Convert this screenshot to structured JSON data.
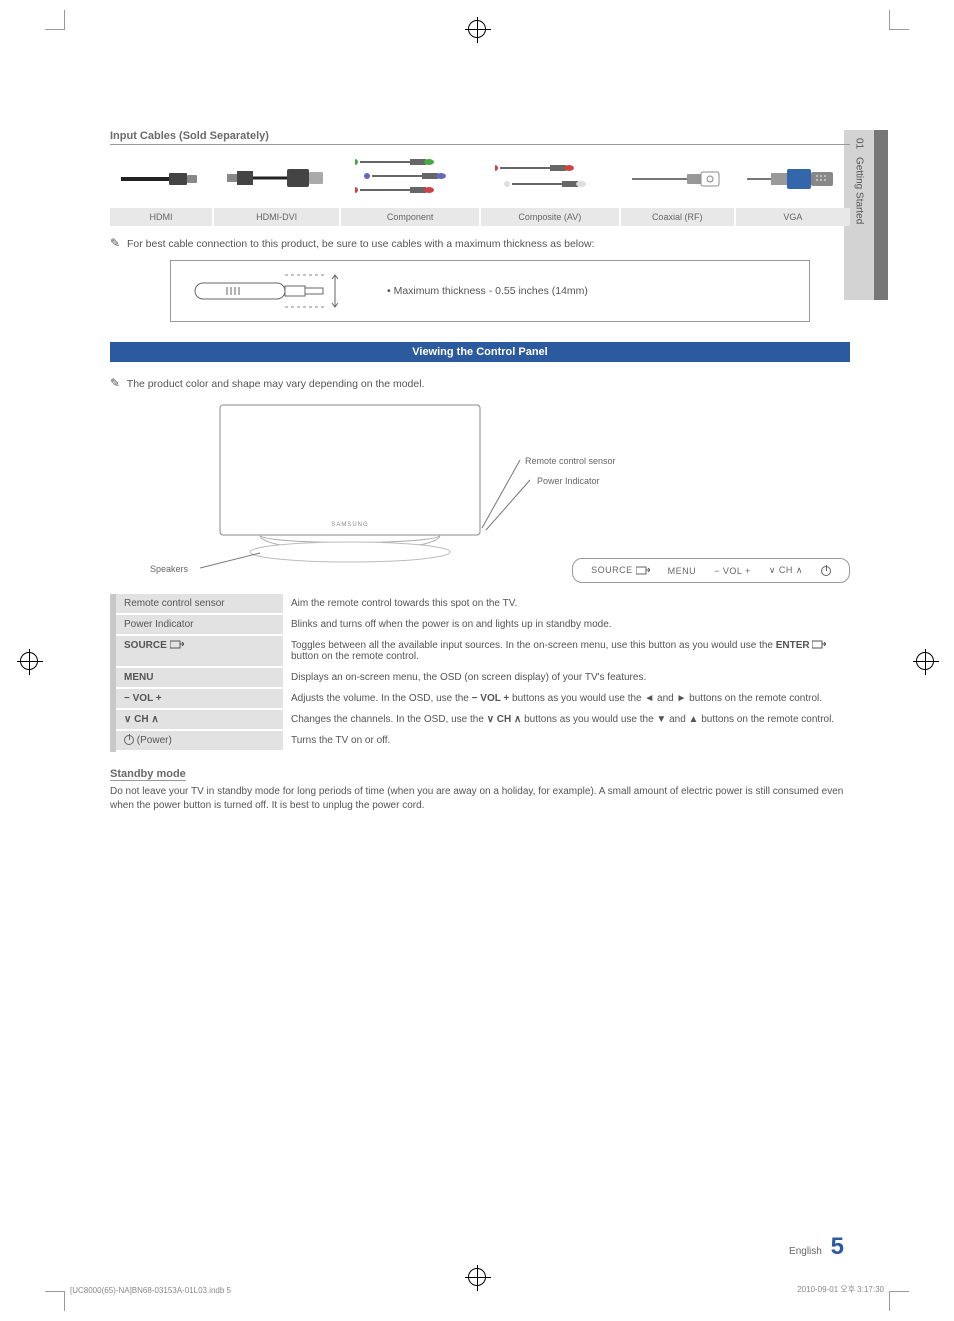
{
  "side_tab": {
    "num": "01",
    "title": "Getting Started"
  },
  "cables": {
    "heading": "Input Cables (Sold Separately)",
    "labels": [
      "HDMI",
      "HDMI-DVI",
      "Component",
      "Composite (AV)",
      "Coaxial (RF)",
      "VGA"
    ]
  },
  "note1": "For best cable connection to this product, be sure to use cables with a maximum thickness as below:",
  "thickness": "Maximum thickness - 0.55 inches (14mm)",
  "banner": "Viewing the Control Panel",
  "note2": "The product color and shape may vary depending on the model.",
  "tv_labels": {
    "remote_sensor": "Remote control sensor",
    "power_indicator": "Power Indicator",
    "speakers": "Speakers"
  },
  "button_strip": {
    "source": "SOURCE",
    "menu": "MENU",
    "vol": "− VOL +",
    "ch": "∨ CH ∧"
  },
  "controls": [
    {
      "name": "Remote control sensor",
      "desc": "Aim the remote control towards this spot on the TV."
    },
    {
      "name": "Power Indicator",
      "desc": "Blinks and turns off when the power is on and lights up in standby mode."
    },
    {
      "name": "SOURCE",
      "desc": "Toggles between all the available input sources. In the on-screen menu, use this button as you would use the ENTER button on the remote control.",
      "icon": "source"
    },
    {
      "name": "MENU",
      "desc": "Displays an on-screen menu, the OSD (on screen display) of your TV's features."
    },
    {
      "name": "− VOL +",
      "desc": "Adjusts the volume. In the OSD, use the − VOL + buttons as you would use the ◄ and ► buttons on the remote control.",
      "bold_name": true
    },
    {
      "name": "∨ CH ∧",
      "desc": "Changes the channels. In the OSD, use the ∨ CH ∧ buttons as you would use the ▼ and ▲ buttons on the remote control.",
      "bold_name": true
    },
    {
      "name": "(Power)",
      "desc": "Turns the TV on or off.",
      "icon": "power"
    }
  ],
  "standby": {
    "heading": "Standby mode",
    "body": "Do not leave your TV in standby mode for long periods of time (when you are away on a holiday, for example). A small amount of electric power is still consumed even when the power button is turned off. It is best to unplug the power cord."
  },
  "footer": {
    "lang": "English",
    "page": "5"
  },
  "bottom": {
    "left": "[UC8000(65)-NA]BN68-03153A-01L03.indb   5",
    "right": "2010-09-01   오후 3:17:30"
  }
}
